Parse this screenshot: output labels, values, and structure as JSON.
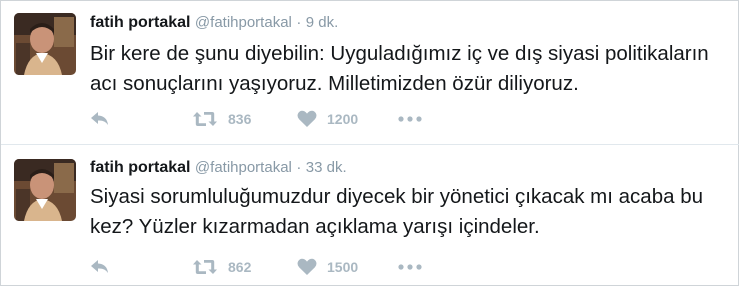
{
  "tweets": [
    {
      "author_name": "fatih portakal",
      "handle": "@fatihportakal",
      "separator": "·",
      "time": "9 dk.",
      "text": "Bir kere de şunu diyebilin: Uyguladığımız iç ve dış siyasi politikaların acı sonuçlarını yaşıyoruz. Milletimizden özür diliyoruz.",
      "retweets": "836",
      "likes": "1200"
    },
    {
      "author_name": "fatih portakal",
      "handle": "@fatihportakal",
      "separator": "·",
      "time": "33 dk.",
      "text": "Siyasi sorumluluğumuzdur diyecek bir yönetici çıkacak mı acaba bu kez? Yüzler kızarmadan açıklama yarışı içindeler.",
      "retweets": "862",
      "likes": "1500"
    }
  ],
  "icons": {
    "reply": "reply-icon",
    "retweet": "retweet-icon",
    "like": "heart-icon",
    "more": "more-icon"
  },
  "colors": {
    "action_gray": "#aab8c2",
    "meta_gray": "#8899a6",
    "text": "#14171a"
  }
}
